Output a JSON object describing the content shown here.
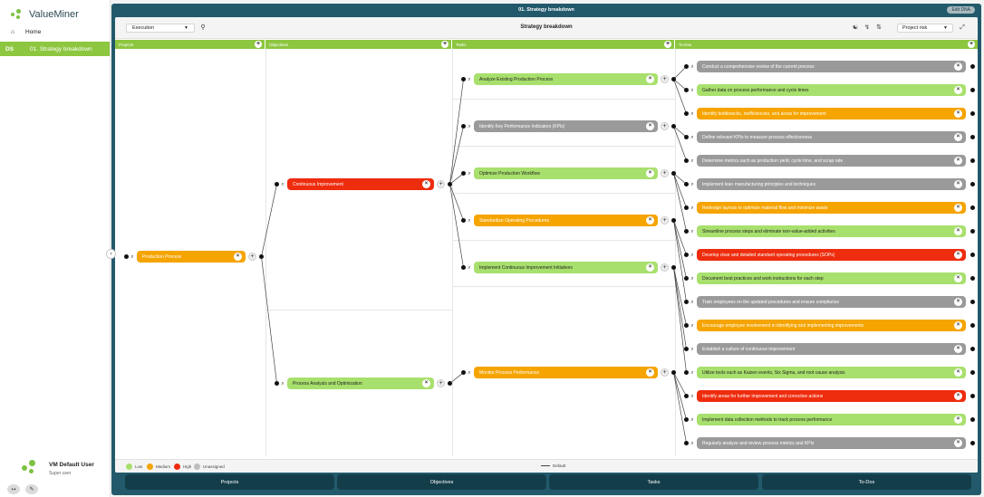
{
  "app": {
    "name": "ValueMiner"
  },
  "sidebar": {
    "home": {
      "icon": "home-icon",
      "label": "Home"
    },
    "active": {
      "code": "DS",
      "label": "01. Strategy breakdown"
    },
    "user": {
      "name": "VM Default User",
      "role": "Super user"
    }
  },
  "window": {
    "title": "01. Strategy breakdown",
    "edit_label": "Edit DNA"
  },
  "toolbar": {
    "view": "Execution",
    "heading": "Strategy breakdown",
    "risk": "Project risk"
  },
  "columns": [
    {
      "key": "projects",
      "label": "Projects"
    },
    {
      "key": "objectives",
      "label": "Objectives"
    },
    {
      "key": "tasks",
      "label": "Tasks"
    },
    {
      "key": "todos",
      "label": "To-Dos"
    }
  ],
  "colors": {
    "low": "#a8e06d",
    "medium": "#f5a400",
    "high": "#ee2c0e",
    "unassigned": "#9a9a9a",
    "brand": "#8dc63f",
    "frame": "#225a6c"
  },
  "tree": {
    "projects": [
      {
        "label": "Production Process",
        "risk": "medium"
      }
    ],
    "objectives": [
      {
        "label": "Continuous Improvement",
        "risk": "high"
      },
      {
        "label": "Process Analysis and Optimization",
        "risk": "low"
      }
    ],
    "tasks": [
      {
        "label": "Analyze Existing Production Process",
        "risk": "low"
      },
      {
        "label": "Identify Key Performance Indicators (KPIs)",
        "risk": "unassigned"
      },
      {
        "label": "Optimize Production Workflow",
        "risk": "low"
      },
      {
        "label": "Standardize Operating Procedures",
        "risk": "medium"
      },
      {
        "label": "Implement Continuous Improvement Initiatives",
        "risk": "low"
      },
      {
        "label": "Monitor Process Performance",
        "risk": "medium"
      }
    ],
    "todos": [
      {
        "label": "Conduct a comprehensive review of the current process",
        "risk": "unassigned"
      },
      {
        "label": "Gather data on process performance and cycle times",
        "risk": "low"
      },
      {
        "label": "Identify bottlenecks, inefficiencies, and areas for improvement",
        "risk": "medium"
      },
      {
        "label": "Define relevant KPIs to measure process effectiveness",
        "risk": "unassigned"
      },
      {
        "label": "Determine metrics such as production yield, cycle time, and scrap rate",
        "risk": "unassigned"
      },
      {
        "label": "Implement lean manufacturing principles and techniques",
        "risk": "unassigned"
      },
      {
        "label": "Redesign layouts to optimize material flow and minimize waste",
        "risk": "medium"
      },
      {
        "label": "Streamline process steps and eliminate non-value-added activities",
        "risk": "low"
      },
      {
        "label": "Develop clear and detailed standard operating procedures (SOPs)",
        "risk": "high"
      },
      {
        "label": "Document best practices and work instructions for each step",
        "risk": "low"
      },
      {
        "label": "Train employees on the updated procedures and ensure compliance",
        "risk": "unassigned"
      },
      {
        "label": "Encourage employee involvement in identifying and implementing improvements",
        "risk": "medium"
      },
      {
        "label": "Establish a culture of continuous improvement",
        "risk": "unassigned"
      },
      {
        "label": "Utilize tools such as Kaizen events, Six Sigma, and root cause analysis",
        "risk": "low"
      },
      {
        "label": "Identify areas for further improvement and corrective actions",
        "risk": "high"
      },
      {
        "label": "Implement data collection methods to track process performance",
        "risk": "low"
      },
      {
        "label": "Regularly analyze and review process metrics and KPIs",
        "risk": "unassigned"
      }
    ]
  },
  "legend": {
    "low": "Low",
    "medium": "Medium",
    "high": "High",
    "unassigned": "Unassigned",
    "default": "Default"
  },
  "footer": [
    "Projects",
    "Objectives",
    "Tasks",
    "To-Dos"
  ]
}
